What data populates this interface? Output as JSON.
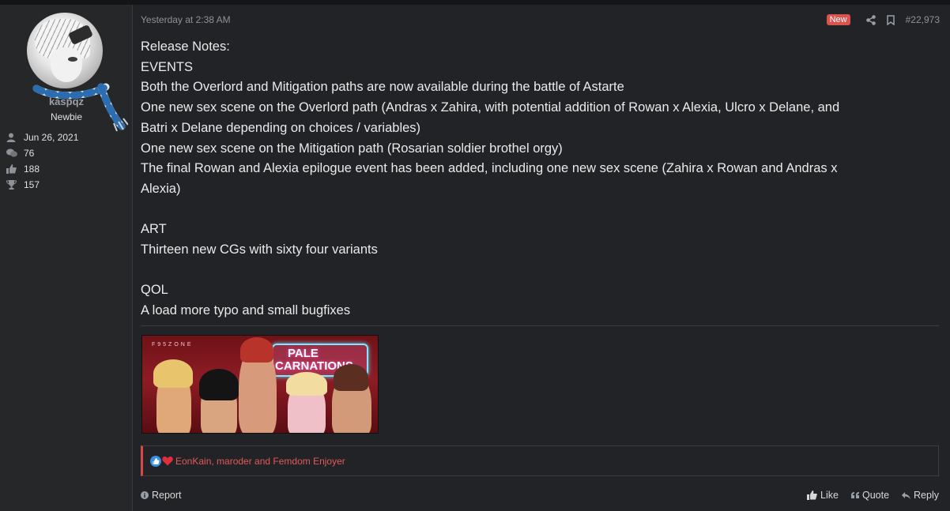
{
  "user": {
    "username": "kaspqz",
    "title": "Newbie",
    "stats": [
      {
        "icon": "user-icon",
        "value": "Jun 26, 2021"
      },
      {
        "icon": "messages-icon",
        "value": "76"
      },
      {
        "icon": "thumbs-up-icon",
        "value": "188"
      },
      {
        "icon": "trophy-icon",
        "value": "157"
      }
    ]
  },
  "post": {
    "date": "Yesterday at 2:38 AM",
    "new_badge": "New",
    "number": "#22,973",
    "lines": [
      "Release Notes:",
      "EVENTS",
      "Both the Overlord and Mitigation paths are now available during the battle of Astarte",
      "One new sex scene on the Overlord path (Andras x Zahira, with potential addition of Rowan x Alexia, Ulcro x Delane, and",
      "Batri x Delane depending on choices / variables)",
      "One new sex scene on the Mitigation path (Rosarian soldier brothel orgy)",
      "The final Rowan and Alexia epilogue event has been added, including one new sex scene (Zahira x Rowan and Andras x",
      "Alexia)",
      "",
      "ART",
      "Thirteen new CGs with sixty four variants",
      "",
      "QOL",
      "A load more typo and small bugfixes"
    ],
    "attachment": {
      "watermark": "F95ZONE",
      "logo_line1": "PALE",
      "logo_line2": "CARNATIONS"
    },
    "reactions": "EonKain, maroder and Femdom Enjoyer"
  },
  "footer": {
    "report": "Report",
    "like": "Like",
    "quote": "Quote",
    "reply": "Reply"
  },
  "colors": {
    "accent_red": "#d74747",
    "badge_red": "#d9534f",
    "background": "#222326"
  }
}
